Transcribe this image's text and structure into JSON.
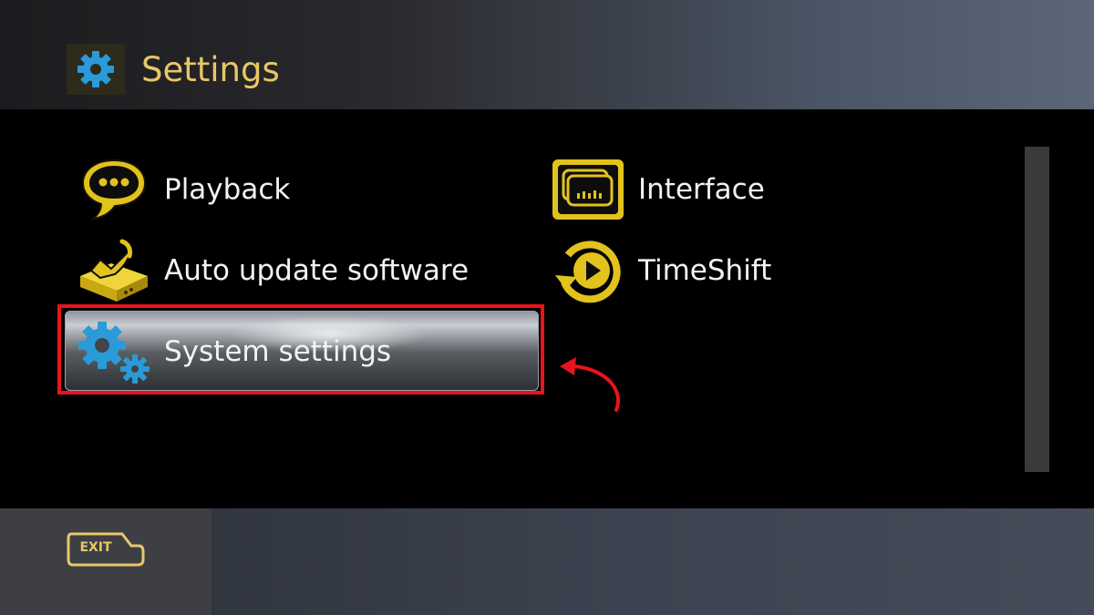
{
  "header": {
    "title": "Settings",
    "icon": "gear-icon"
  },
  "menu": [
    {
      "label": "Playback",
      "icon": "speech-bubble-icon"
    },
    {
      "label": "Interface",
      "icon": "screen-layers-icon"
    },
    {
      "label": "Auto update software",
      "icon": "update-box-icon"
    },
    {
      "label": "TimeShift",
      "icon": "timeshift-icon"
    },
    {
      "label": "System settings",
      "icon": "gears-icon",
      "selected": true
    }
  ],
  "footer": {
    "exit_label": "EXIT"
  },
  "colors": {
    "accent": "#e8c766",
    "icon_blue": "#2b9ad8",
    "highlight": "#e8141c",
    "text": "#f2f2f2"
  }
}
